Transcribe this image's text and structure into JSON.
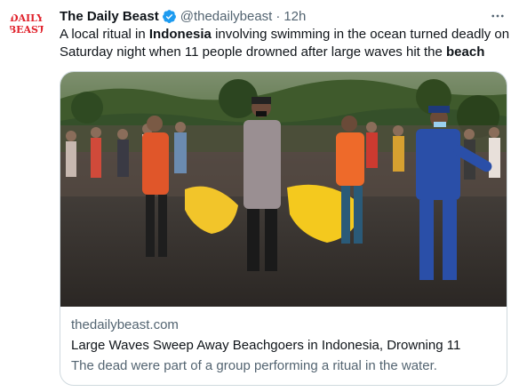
{
  "author": {
    "name": "The Daily Beast",
    "handle": "@thedailybeast",
    "dot": "·",
    "time": "12h",
    "avatar_text_line1": "DAILY",
    "avatar_text_line2": "BEAST",
    "avatar_color": "#e0202a"
  },
  "tweet": {
    "text_parts": [
      {
        "text": "A local ritual in ",
        "bold": false
      },
      {
        "text": "Indonesia",
        "bold": true
      },
      {
        "text": " involving swimming in the ocean turned deadly on Saturday night when 11 people drowned after large waves hit the ",
        "bold": false
      },
      {
        "text": "beach",
        "bold": true
      }
    ]
  },
  "card": {
    "domain": "thedailybeast.com",
    "title": "Large Waves Sweep Away Beachgoers in Indonesia, Drowning 11",
    "description": "The dead were part of a group performing a ritual in the water."
  },
  "icons": {
    "verified": "verified-badge-icon",
    "more": "more-options-icon"
  },
  "colors": {
    "verified_blue": "#1d9bf0",
    "secondary_text": "#536471",
    "primary_text": "#0f1419",
    "border": "#cfd9de"
  }
}
